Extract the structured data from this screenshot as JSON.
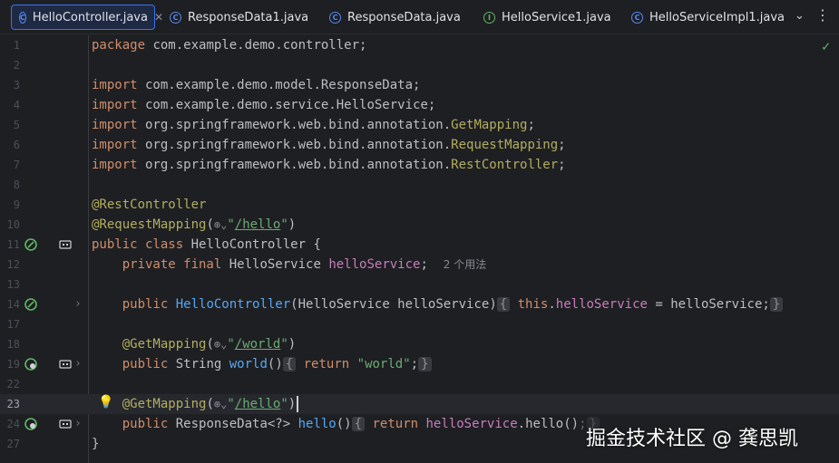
{
  "tabs": [
    {
      "label": "HelloController.java",
      "icon": "class-icon",
      "active": true
    },
    {
      "label": "ResponseData1.java",
      "icon": "class-icon",
      "active": false
    },
    {
      "label": "ResponseData.java",
      "icon": "class-icon",
      "active": false
    },
    {
      "label": "HelloService1.java",
      "icon": "interface-icon",
      "active": false
    },
    {
      "label": "HelloServiceImpl1.java",
      "icon": "class-icon",
      "active": false
    }
  ],
  "tab_close_glyph": "✕",
  "line_numbers": [
    "1",
    "2",
    "3",
    "4",
    "5",
    "6",
    "7",
    "8",
    "9",
    "10",
    "11",
    "12",
    "13",
    "14",
    "17",
    "18",
    "19",
    "22",
    "23",
    "24",
    "27"
  ],
  "code": {
    "l1_kw": "package",
    "l1_rest": " com.example.demo.controller;",
    "l3_kw": "import",
    "l3_rest": " com.example.demo.model.ResponseData;",
    "l4_kw": "import",
    "l4_rest": " com.example.demo.service.HelloService;",
    "l5_kw": "import",
    "l5_rest": " org.springframework.web.bind.annotation.",
    "l5_ann": "GetMapping",
    "l5_end": ";",
    "l6_kw": "import",
    "l6_rest": " org.springframework.web.bind.annotation.",
    "l6_ann": "RequestMapping",
    "l6_end": ";",
    "l7_kw": "import",
    "l7_rest": " org.springframework.web.bind.annotation.",
    "l7_ann": "RestController",
    "l7_end": ";",
    "l9_ann": "@RestController",
    "l10_ann": "@RequestMapping",
    "l10_open": "(",
    "l10_q1": "\"",
    "l10_url": "/hello",
    "l10_q2": "\"",
    "l10_close": ")",
    "l11_kw": "public class",
    "l11_rest": " HelloController {",
    "l12_kw": "private final",
    "l12_type": " HelloService ",
    "l12_fld": "helloService",
    "l12_end": ";",
    "l12_hint": "2 个用法",
    "l14_kw": "public",
    "l14_fn": "HelloController",
    "l14_params": "(HelloService helloService)",
    "l14_fold_open": "{",
    "l14_this": "this",
    "l14_dot": ".",
    "l14_fld": "helloService",
    "l14_assign": " = helloService;",
    "l14_fold_close": "}",
    "l17_ann": "@GetMapping",
    "l17_open": "(",
    "l17_q1": "\"",
    "l17_url": "/world",
    "l17_q2": "\"",
    "l17_close": ")",
    "l18_kw": "public",
    "l18_type": " String ",
    "l18_fn": "world",
    "l18_paren": "()",
    "l18_fold_open": "{",
    "l18_ret": "return",
    "l18_str": "\"world\"",
    "l18_end": ";",
    "l18_fold_close": "}",
    "l22_ann": "@GetMapping",
    "l22_open": "(",
    "l22_q1": "\"",
    "l22_url": "/hello",
    "l22_q2": "\"",
    "l22_close": ")",
    "l23_kw": "public",
    "l23_type": " ResponseData<?> ",
    "l23_fn": "hello",
    "l23_paren": "()",
    "l23_fold_open": "{",
    "l23_ret": "return",
    "l23_fld": "helloService",
    "l23_call": ".hello();",
    "l23_fold_close": "}",
    "l27": "}"
  },
  "globe_glyph": "⊕⌄",
  "watermark": "掘金技术社区 @ 龚思凯",
  "colors": {
    "keyword": "#cf8e6d",
    "annotation": "#b3ae60",
    "string": "#6aab73",
    "field": "#c77dbb",
    "method": "#56a8f5"
  }
}
